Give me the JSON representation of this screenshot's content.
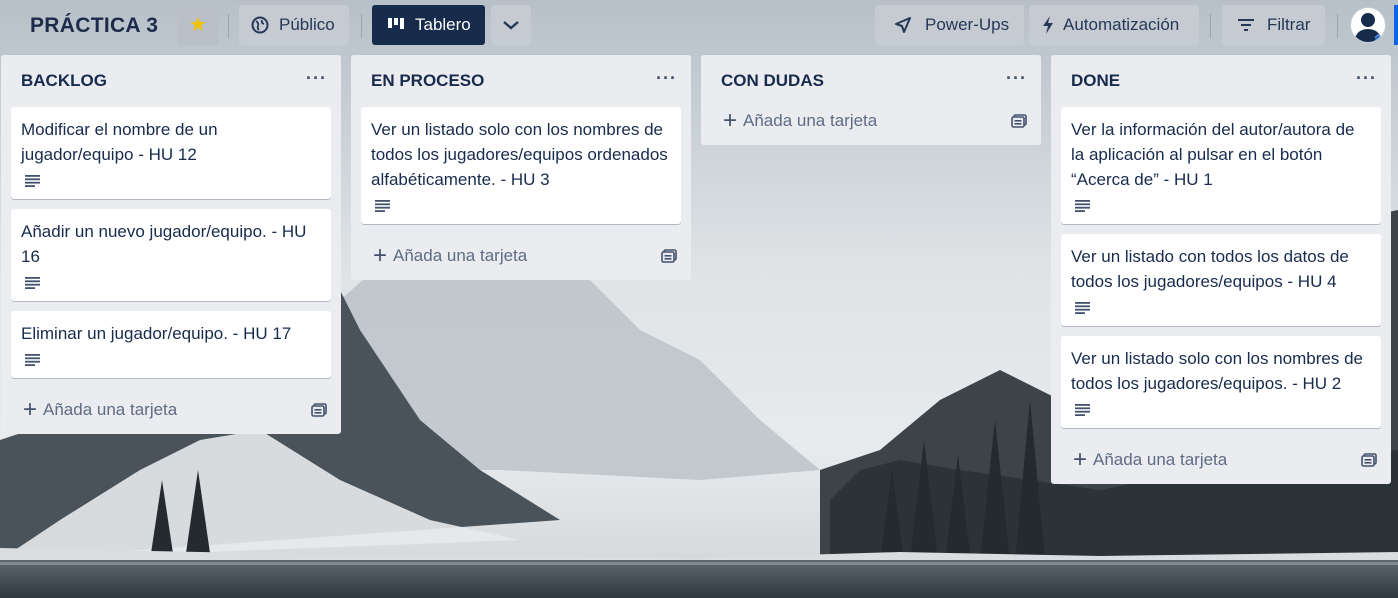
{
  "header": {
    "board_title": "PRÁCTICA 3",
    "visibility_label": "Público",
    "view_label": "Tablero",
    "powerups_label": "Power-Ups",
    "automation_label": "Automatización",
    "filter_label": "Filtrar"
  },
  "lists": [
    {
      "title": "BACKLOG",
      "cards": [
        "Modificar el nombre de un jugador/equipo - HU 12",
        "Añadir un nuevo jugador/equipo. - HU 16",
        "Eliminar un jugador/equipo. - HU 17"
      ],
      "add_label": "Añada una tarjeta"
    },
    {
      "title": "EN PROCESO",
      "cards": [
        "Ver un listado solo con los nombres de todos los jugadores/equipos ordenados alfabéticamente. - HU 3"
      ],
      "add_label": "Añada una tarjeta"
    },
    {
      "title": "CON DUDAS",
      "cards": [],
      "add_label": "Añada una tarjeta"
    },
    {
      "title": "DONE",
      "cards": [
        "Ver la información del autor/autora de la aplicación al pulsar en el botón “Acerca de” - HU 1",
        "Ver un listado con todos los datos de todos los jugadores/equipos - HU 4",
        "Ver un listado solo con los nombres de todos los jugadores/equipos. - HU 2"
      ],
      "add_label": "Añada una tarjeta"
    }
  ],
  "icons": {
    "star": "star-icon",
    "visibility": "globe-icon",
    "view": "board-icon",
    "view_switch": "chevron-down-icon",
    "powerups": "rocket-icon",
    "automation": "lightning-icon",
    "filter": "filter-icon",
    "card_badge": "description-icon",
    "add": "plus-icon",
    "template": "template-icon",
    "list_menu": "ellipsis-icon"
  },
  "colors": {
    "star": "#f2c200",
    "board_button": "#172b4d",
    "list_bg": "#ebecf0",
    "card_bg": "#ffffff"
  }
}
